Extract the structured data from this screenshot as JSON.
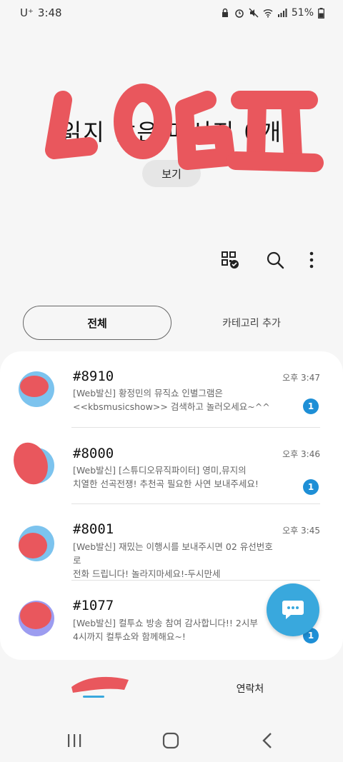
{
  "status_bar": {
    "carrier": "U⁺",
    "time": "3:48",
    "battery": "51%"
  },
  "hero": {
    "title": "읽지 않은 메시지 0개",
    "view_button": "보기"
  },
  "toolbar": {
    "icons": [
      "qr-check-icon",
      "search-icon",
      "more-vertical-icon"
    ]
  },
  "tabs": {
    "all": "전체",
    "add_category": "카테고리 추가"
  },
  "messages": [
    {
      "sender": "#8910",
      "time": "오후 3:47",
      "preview_line1": "[Web발신] 황정민의 뮤직쇼 인별그램은",
      "preview_line2": "<<kbsmusicshow>> 검색하고 놀러오세요~^^",
      "unread": "1"
    },
    {
      "sender": "#8000",
      "time": "오후 3:46",
      "preview_line1": "[Web발신] [스튜디오뮤직파이터] 영미,뮤지의",
      "preview_line2": "치열한 선곡전쟁! 추천곡 필요한 사연 보내주세요!",
      "unread": "1"
    },
    {
      "sender": "#8001",
      "time": "오후 3:45",
      "preview_line1": "[Web발신] 재밌는 이행시를 보내주시면 02 유선번호로",
      "preview_line2": "전화 드립니다! 놀라지마세요!-두시만세",
      "unread": ""
    },
    {
      "sender": "#1077",
      "time": "",
      "preview_line1": "[Web발신] 컬투쇼 방송 참여 감사합니다!! 2시부",
      "preview_line2": "4시까지 컬투쇼와 함께해요~!",
      "unread": "1"
    }
  ],
  "bottom_nav": {
    "contacts": "연락처"
  },
  "colors": {
    "accent": "#39a8dd",
    "badge": "#1e8fd6",
    "scribble": "#e9575d"
  }
}
